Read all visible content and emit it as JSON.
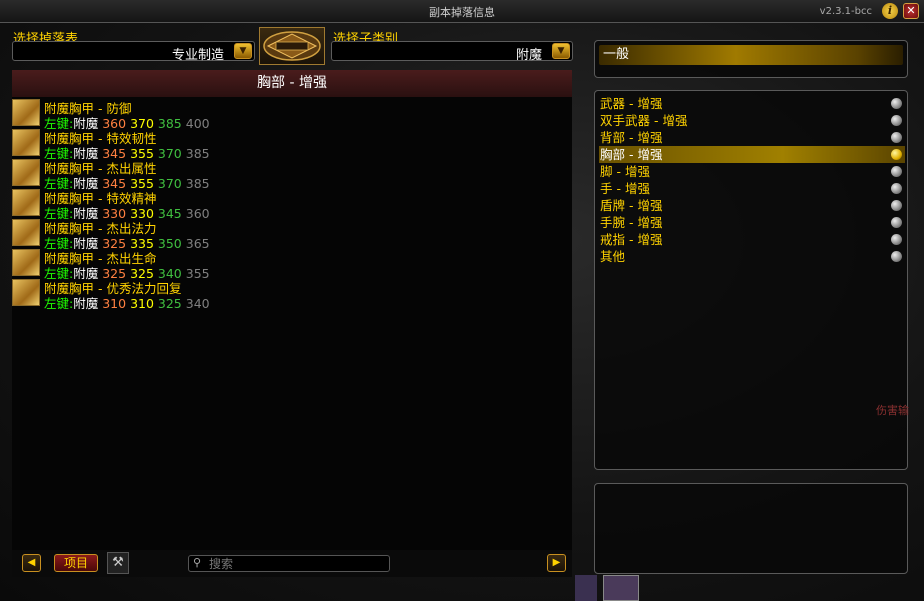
{
  "window": {
    "title": "副本掉落信息",
    "version": "v2.3.1-bcc",
    "info_icon": "i",
    "close_icon": "✕"
  },
  "select_drop_label": "选择掉落表",
  "select_subcat_label": "选择子类别",
  "drop_value": "专业制造",
  "subcat_value": "附魔",
  "list_title": "胸部 - 增强",
  "items": [
    {
      "name": "附魔胸甲 - 防御",
      "key": "左键:",
      "skill": "附魔",
      "r1": "360",
      "r2": "370",
      "r3": "385",
      "r4": "400"
    },
    {
      "name": "附魔胸甲 - 特效韧性",
      "key": "左键:",
      "skill": "附魔",
      "r1": "345",
      "r2": "355",
      "r3": "370",
      "r4": "385"
    },
    {
      "name": "附魔胸甲 - 杰出属性",
      "key": "左键:",
      "skill": "附魔",
      "r1": "345",
      "r2": "355",
      "r3": "370",
      "r4": "385"
    },
    {
      "name": "附魔胸甲 - 特效精神",
      "key": "左键:",
      "skill": "附魔",
      "r1": "330",
      "r2": "330",
      "r3": "345",
      "r4": "360"
    },
    {
      "name": "附魔胸甲 - 杰出法力",
      "key": "左键:",
      "skill": "附魔",
      "r1": "325",
      "r2": "335",
      "r3": "350",
      "r4": "365"
    },
    {
      "name": "附魔胸甲 - 杰出生命",
      "key": "左键:",
      "skill": "附魔",
      "r1": "325",
      "r2": "325",
      "r3": "340",
      "r4": "355"
    },
    {
      "name": "附魔胸甲 - 优秀法力回复",
      "key": "左键:",
      "skill": "附魔",
      "r1": "310",
      "r2": "310",
      "r3": "325",
      "r4": "340"
    }
  ],
  "bottom": {
    "items_button": "项目",
    "search_placeholder": "搜索"
  },
  "general_header": "一般",
  "categories": [
    {
      "label": "武器 - 增强",
      "selected": false
    },
    {
      "label": "双手武器 - 增强",
      "selected": false
    },
    {
      "label": "背部 - 增强",
      "selected": false
    },
    {
      "label": "胸部 - 增强",
      "selected": true
    },
    {
      "label": "脚 - 增强",
      "selected": false
    },
    {
      "label": "手 - 增强",
      "selected": false
    },
    {
      "label": "盾牌 - 增强",
      "selected": false
    },
    {
      "label": "手腕 - 增强",
      "selected": false
    },
    {
      "label": "戒指 - 增强",
      "selected": false
    },
    {
      "label": "其他",
      "selected": false
    }
  ],
  "background_text": "伤害输",
  "colors": {
    "gold": "#ffd200",
    "green_key": "#1eff00",
    "rank_orange": "#ff8040",
    "rank_yellow": "#ffff00",
    "rank_green": "#40bf40",
    "rank_gray": "#808080"
  }
}
